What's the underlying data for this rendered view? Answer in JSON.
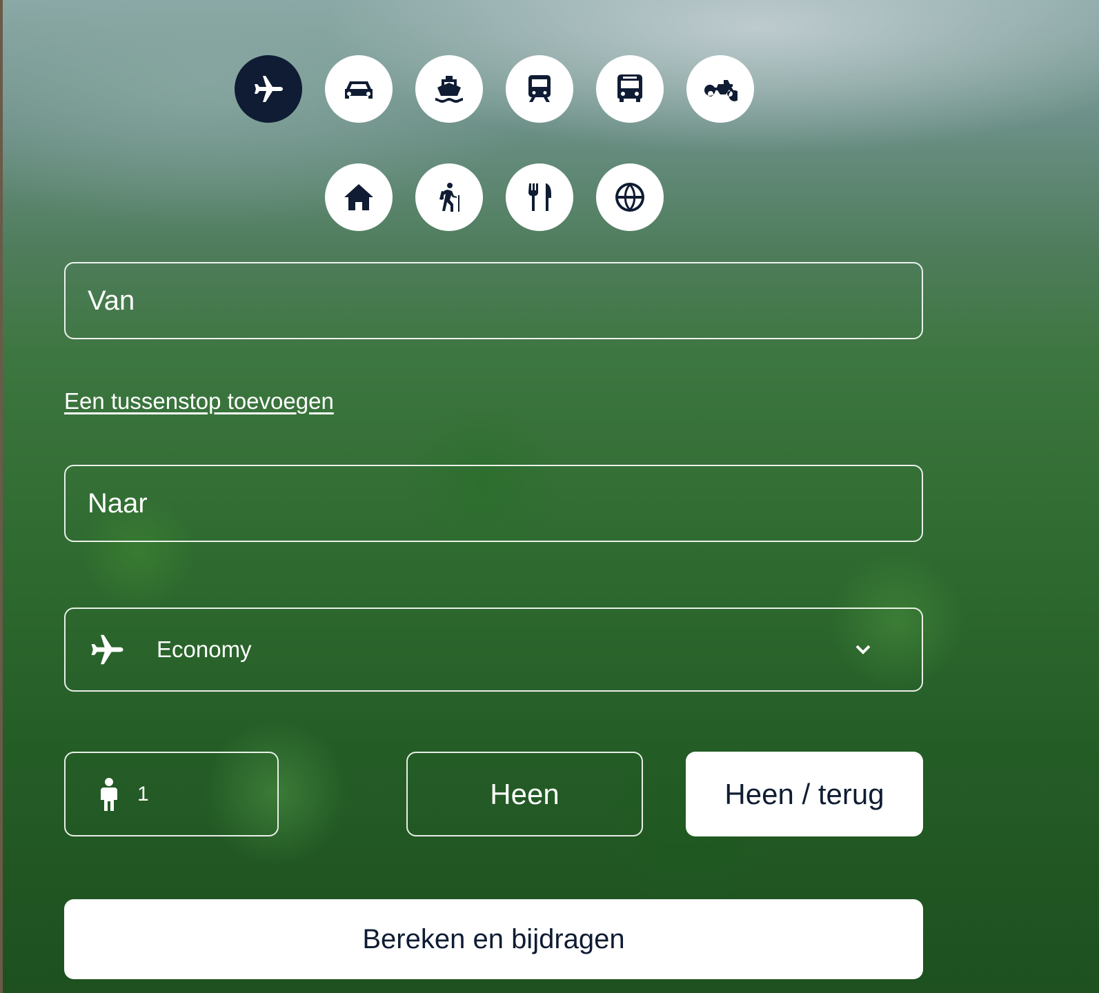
{
  "transport_modes": [
    {
      "id": "plane",
      "icon": "plane-icon",
      "active": true
    },
    {
      "id": "car",
      "icon": "car-icon",
      "active": false
    },
    {
      "id": "ship",
      "icon": "ship-icon",
      "active": false
    },
    {
      "id": "train",
      "icon": "train-icon",
      "active": false
    },
    {
      "id": "bus",
      "icon": "bus-icon",
      "active": false
    },
    {
      "id": "motorcycle",
      "icon": "motorcycle-icon",
      "active": false
    }
  ],
  "activity_modes": [
    {
      "id": "home",
      "icon": "home-icon"
    },
    {
      "id": "hiking",
      "icon": "hiking-icon"
    },
    {
      "id": "restaurant",
      "icon": "restaurant-icon"
    },
    {
      "id": "globe",
      "icon": "globe-icon"
    }
  ],
  "form": {
    "from_placeholder": "Van",
    "add_stop_link": "Een tussenstop toevoegen",
    "to_placeholder": "Naar",
    "cabin_class": "Economy",
    "passengers": "1",
    "one_way_label": "Heen",
    "round_trip_label": "Heen / terug",
    "submit_label": "Bereken en bijdragen"
  },
  "colors": {
    "accent_dark": "#0f1c33",
    "white": "#ffffff"
  }
}
